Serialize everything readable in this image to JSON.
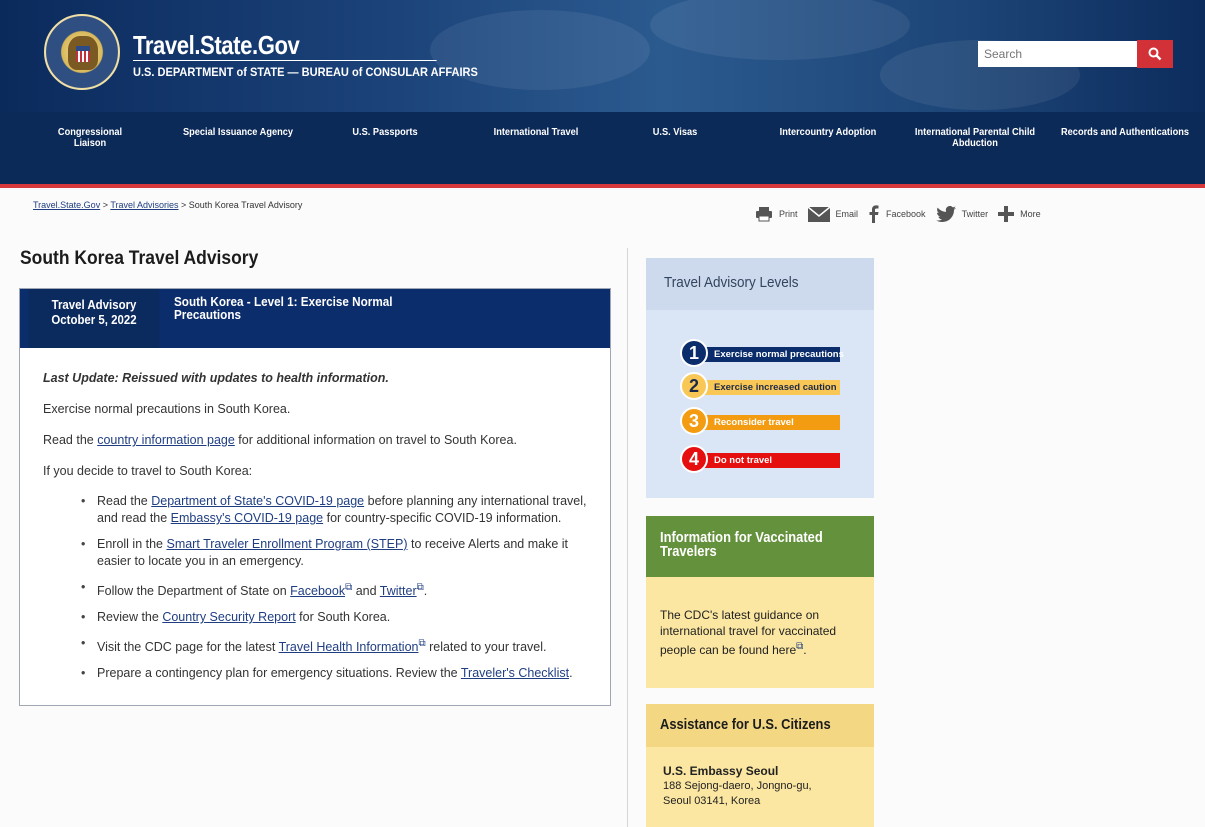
{
  "header": {
    "site_title": "Travel.State.Gov",
    "site_subtitle": "U.S. DEPARTMENT of STATE — BUREAU of CONSULAR AFFAIRS",
    "search_placeholder": "Search"
  },
  "nav": {
    "items": [
      "Congressional Liaison",
      "Special Issuance Agency",
      "U.S. Passports",
      "International Travel",
      "U.S. Visas",
      "Intercountry Adoption",
      "International Parental Child Abduction",
      "Records and Authentications"
    ]
  },
  "breadcrumb": {
    "home": "Travel.State.Gov",
    "sep1": " > ",
    "section": "Travel Advisories",
    "sep2": " > ",
    "current": "South Korea Travel Advisory"
  },
  "share": {
    "print": "Print",
    "email": "Email",
    "facebook": "Facebook",
    "twitter": "Twitter",
    "more": "More"
  },
  "page_title": "South Korea Travel Advisory",
  "advisory": {
    "label_line1": "Travel Advisory",
    "label_line2": "October 5, 2022",
    "title": "South Korea - Level 1: Exercise Normal Precautions",
    "last_update": "Last Update: Reissued with updates to health information.",
    "p1": "Exercise normal precautions in South Korea.",
    "p2_pre": "Read the ",
    "p2_link": "country information page",
    "p2_post": " for additional information on travel to South Korea.",
    "p3": "If you decide to travel to South Korea:",
    "b1_pre": "Read the ",
    "b1_link1": "Department of State's COVID-19 page",
    "b1_mid": " before planning any international travel, and read the ",
    "b1_link2": "Embassy's COVID-19 page",
    "b1_post": " for country-specific COVID-19 information.",
    "b2_pre": "Enroll in the ",
    "b2_link": "Smart Traveler Enrollment Program (STEP)",
    "b2_post": " to receive Alerts and make it easier to locate you in an emergency.",
    "b3_pre": "Follow the Department of State on ",
    "b3_link1": "Facebook",
    "b3_mid": " and ",
    "b3_link2": "Twitter",
    "b3_post": ".",
    "b4_pre": "Review the ",
    "b4_link": "Country Security Report",
    "b4_post": " for South Korea.",
    "b5_pre": "Visit the CDC page for the latest ",
    "b5_link": "Travel Health Information",
    "b5_post": " related to your travel.",
    "b6_pre": "Prepare a contingency plan for emergency situations. Review the ",
    "b6_link": "Traveler's Checklist",
    "b6_post": "."
  },
  "levels": {
    "heading": "Travel Advisory Levels",
    "items": [
      {
        "num": "1",
        "label": "Exercise normal precautions",
        "color": "#0b2d6b",
        "text_color": "#ffffff"
      },
      {
        "num": "2",
        "label": "Exercise increased caution",
        "color": "#f9c755",
        "text_color": "#1c2a4a"
      },
      {
        "num": "3",
        "label": "Reconsider travel",
        "color": "#f39c12",
        "text_color": "#ffffff"
      },
      {
        "num": "4",
        "label": "Do not travel",
        "color": "#e60f0f",
        "text_color": "#ffffff"
      }
    ]
  },
  "vaccinated": {
    "heading_line1": "Information for Vaccinated",
    "heading_line2": "Travelers",
    "text_pre": "The CDC's latest guidance on international travel for vaccinated people can be found ",
    "link": "here",
    "text_post": "."
  },
  "assistance": {
    "heading": "Assistance for U.S. Citizens",
    "embassy": "U.S. Embassy Seoul",
    "addr1": "188 Sejong-daero, Jongno-gu,",
    "addr2": "Seoul 03141, Korea"
  },
  "colors": {
    "header_blue": "#1a4178",
    "nav_blue": "#0c2a57",
    "accent_red": "#d23137",
    "vacc_green": "#64913c",
    "sidebar_yellow": "#fbe7a2"
  }
}
